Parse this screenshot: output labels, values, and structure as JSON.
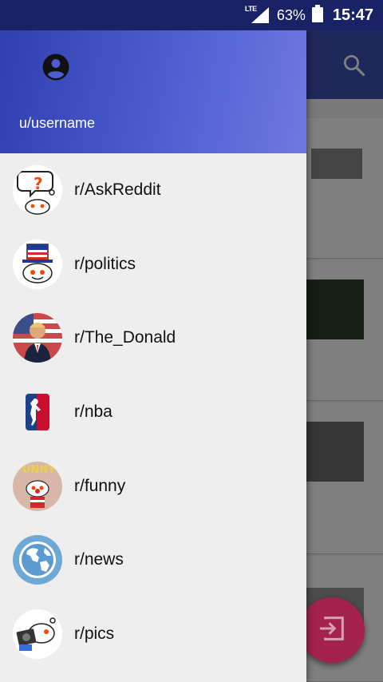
{
  "status_bar": {
    "network": "LTE",
    "battery": "63%",
    "time": "15:47"
  },
  "drawer": {
    "username": "u/username",
    "subreddits": [
      {
        "label": "r/AskReddit",
        "icon": "askreddit-icon"
      },
      {
        "label": "r/politics",
        "icon": "politics-icon"
      },
      {
        "label": "r/The_Donald",
        "icon": "the-donald-icon"
      },
      {
        "label": "r/nba",
        "icon": "nba-icon"
      },
      {
        "label": "r/funny",
        "icon": "funny-icon"
      },
      {
        "label": "r/news",
        "icon": "news-icon"
      },
      {
        "label": "r/pics",
        "icon": "pics-icon"
      }
    ]
  },
  "colors": {
    "status_bar": "#1a2266",
    "header_start": "#2f3fb0",
    "header_end": "#6f78e2",
    "fab": "#a3224e",
    "drawer_bg": "#eeeeee"
  }
}
